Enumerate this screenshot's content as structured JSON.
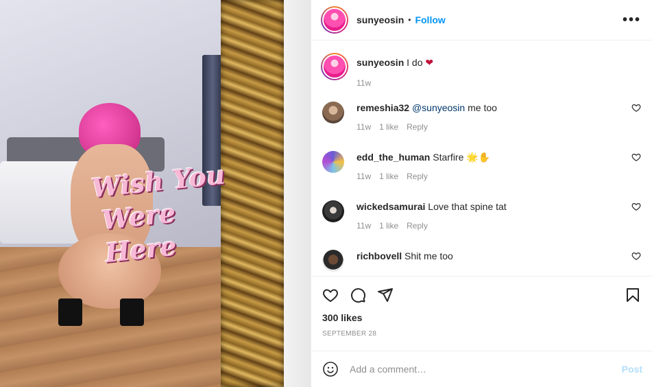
{
  "media": {
    "overlay_line1": "Wish You",
    "overlay_line2": "Were Here"
  },
  "header": {
    "username": "sunyeosin",
    "separator": "•",
    "follow_label": "Follow",
    "more_icon": "more-horizontal-icon"
  },
  "caption": {
    "username": "sunyeosin",
    "text": "I do",
    "emoji": "❤",
    "time": "11w"
  },
  "comments": [
    {
      "username": "remeshia32",
      "mention": "@sunyeosin",
      "text": " me too",
      "time": "11w",
      "likes": "1 like",
      "reply": "Reply"
    },
    {
      "username": "edd_the_human",
      "mention": "",
      "text": "Starfire 🌟✋",
      "time": "11w",
      "likes": "1 like",
      "reply": "Reply"
    },
    {
      "username": "wickedsamurai",
      "mention": "",
      "text": "Love that spine tat",
      "time": "11w",
      "likes": "1 like",
      "reply": "Reply"
    },
    {
      "username": "richbovell",
      "mention": "",
      "text": "Shit me too",
      "time": "",
      "likes": "",
      "reply": ""
    }
  ],
  "actions": {
    "likes": "300 likes",
    "date": "SEPTEMBER 28"
  },
  "add_comment": {
    "placeholder": "Add a comment…",
    "post_label": "Post"
  },
  "colors": {
    "accent": "#0095f6",
    "post_disabled": "#b2dffc",
    "muted": "#8e8e8e"
  }
}
